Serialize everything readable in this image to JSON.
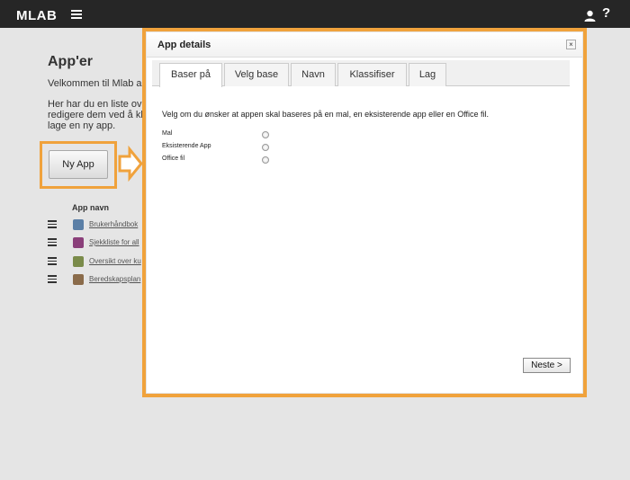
{
  "header": {
    "logo": "MLAB",
    "menu_icon": "hamburger-icon",
    "user_icon": "user-icon",
    "help_label": "?"
  },
  "page": {
    "title": "App'er",
    "welcome": "Velkommen til Mlab a",
    "intro_lines": [
      "Her har du en liste ov",
      "redigere dem ved å kl",
      "lage en ny app."
    ],
    "new_app_button": "Ny App",
    "list_header": "App navn",
    "apps": [
      {
        "name": "Brukerhåndbok",
        "icon_color": "#5b7fa6"
      },
      {
        "name": "Sjekkliste for all",
        "icon_color": "#8a3f7a"
      },
      {
        "name": "Oversikt over ku",
        "icon_color": "#7a8b4a"
      },
      {
        "name": "Beredskapsplan",
        "icon_color": "#8a6b4a"
      }
    ]
  },
  "modal": {
    "title": "App details",
    "close_label": "×",
    "tabs": [
      {
        "label": "Baser på",
        "active": true
      },
      {
        "label": "Velg base",
        "active": false
      },
      {
        "label": "Navn",
        "active": false
      },
      {
        "label": "Klassifiser",
        "active": false
      },
      {
        "label": "Lag",
        "active": false
      }
    ],
    "instruction": "Velg om du ønsker at appen skal baseres på en mal, en eksisterende app eller en Office fil.",
    "options": [
      {
        "label": "Mal",
        "selected": false
      },
      {
        "label": "Eksisterende App",
        "selected": false
      },
      {
        "label": "Office fil",
        "selected": false
      }
    ],
    "next_button": "Neste >"
  },
  "colors": {
    "highlight": "#f0a23c",
    "topbar": "#262626",
    "background": "#e5e5e5"
  }
}
